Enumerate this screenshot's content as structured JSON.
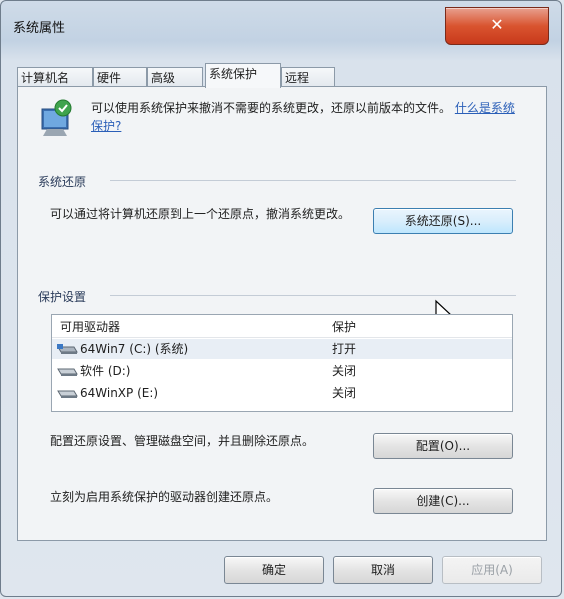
{
  "window": {
    "title": "系统属性",
    "close_label": "✕"
  },
  "tabs": [
    {
      "label": "计算机名",
      "active": false
    },
    {
      "label": "硬件",
      "active": false
    },
    {
      "label": "高级",
      "active": false
    },
    {
      "label": "系统保护",
      "active": true
    },
    {
      "label": "远程",
      "active": false
    }
  ],
  "intro": {
    "text": "可以使用系统保护来撤消不需要的系统更改，还原以前版本的文件。",
    "link": "什么是系统保护?"
  },
  "system_restore": {
    "group_title": "系统还原",
    "description": "可以通过将计算机还原到上一个还原点，撤消系统更改。",
    "button": "系统还原(S)..."
  },
  "protection": {
    "group_title": "保护设置",
    "columns": {
      "drive": "可用驱动器",
      "protection": "保护"
    },
    "drives": [
      {
        "name": "64Win7  (C:) (系统)",
        "status": "打开",
        "icon": "system-drive-icon"
      },
      {
        "name": "软件  (D:)",
        "status": "关闭",
        "icon": "drive-icon"
      },
      {
        "name": "64WinXP  (E:)",
        "status": "关闭",
        "icon": "drive-icon"
      }
    ],
    "configure_description": "配置还原设置、管理磁盘空间，并且删除还原点。",
    "configure_button": "配置(O)...",
    "create_description": "立刻为启用系统保护的驱动器创建还原点。",
    "create_button": "创建(C)..."
  },
  "footer": {
    "ok": "确定",
    "cancel": "取消",
    "apply": "应用(A)"
  },
  "colors": {
    "link": "#2b5fb8",
    "close_button": "#d9542f",
    "hover_button": "#bee6fd"
  }
}
